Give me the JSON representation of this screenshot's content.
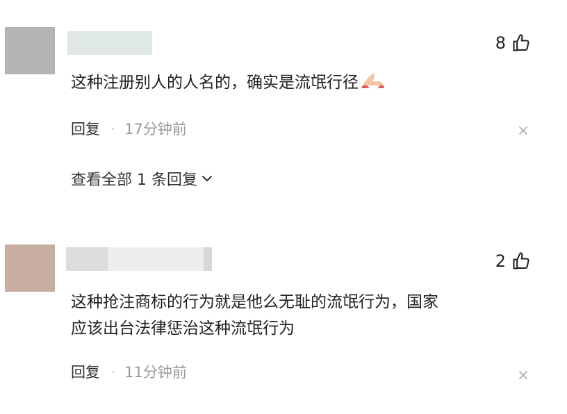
{
  "comments": [
    {
      "likes": "8",
      "text": "这种注册别人的人名的，确实是流氓行径",
      "reply_label": "回复",
      "dot": "·",
      "time": "17分钟前",
      "view_replies": "查看全部 1 条回复"
    },
    {
      "likes": "2",
      "text_line1": "这种抢注商标的行为就是他么无耻的流氓行为，国家",
      "text_line2": "应该出台法律惩治这种流氓行为",
      "reply_label": "回复",
      "dot": "·",
      "time": "11分钟前"
    }
  ],
  "icons": {
    "like": "thumbs-up-icon",
    "close": "close-icon",
    "chevron": "chevron-down-icon",
    "emoji": "praying-hands-emoji"
  },
  "colors": {
    "text": "#222222",
    "muted": "#999999",
    "avatar1": "#b4b4b4",
    "avatar2": "#c8ada3"
  }
}
